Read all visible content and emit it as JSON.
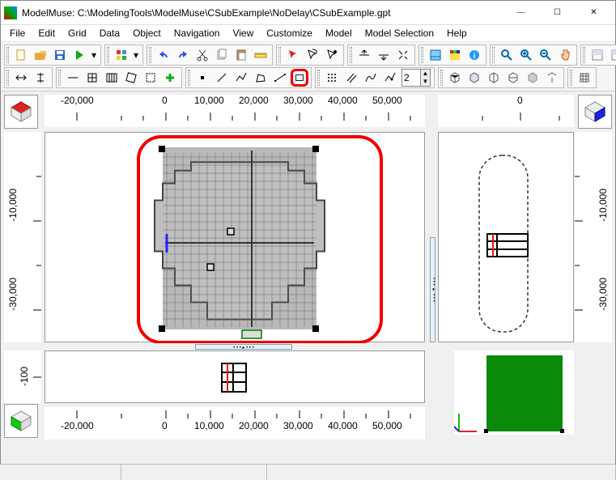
{
  "title": "ModelMuse: C:\\ModelingTools\\ModelMuse\\CSubExample\\NoDelay\\CSubExample.gpt",
  "window_controls": {
    "min": "—",
    "max": "☐",
    "close": "✕"
  },
  "menu": [
    "File",
    "Edit",
    "Grid",
    "Data",
    "Object",
    "Navigation",
    "View",
    "Customize",
    "Model",
    "Model Selection",
    "Help"
  ],
  "spin_value": "2",
  "axes": {
    "top_left": {
      "labels": [
        "-20,000",
        "0",
        "10,000",
        "20,000",
        "30,000",
        "40,000",
        "50,000"
      ],
      "x": [
        84,
        199,
        254,
        309,
        364,
        419,
        474
      ]
    },
    "top_right": {
      "labels": [
        "0"
      ],
      "x": [
        640
      ]
    },
    "left_main": {
      "labels": [
        "-30,000",
        "-10,000"
      ],
      "y": [
        344,
        234
      ]
    },
    "left_bottom": {
      "labels": [
        "-100"
      ],
      "y": [
        466
      ]
    },
    "right_main": {
      "labels": [
        "-30,000",
        "-10,000"
      ],
      "y": [
        344,
        234
      ]
    },
    "bottom": {
      "labels": [
        "-20,000",
        "0",
        "10,000",
        "20,000",
        "30,000",
        "40,000",
        "50,000"
      ],
      "x": [
        84,
        199,
        254,
        309,
        364,
        419,
        474
      ]
    }
  },
  "chart_data": {
    "type": "map-views",
    "description": "ModelMuse grid views (top/plan, front, side, 3D) of a MODFLOW finite-difference grid",
    "plan_view": {
      "x_range": [
        -20000,
        50000
      ],
      "y_range": [
        -30000,
        -10000
      ],
      "grid_active_extent_x": [
        8000,
        32000
      ],
      "grid_active_extent_y": [
        -34000,
        4000
      ],
      "selected_cells": [
        [
          22000,
          -14000
        ],
        [
          22000,
          -22000
        ]
      ],
      "highlighted_object_bbox": true
    },
    "front_view": {
      "x_range": [
        -20000,
        50000
      ],
      "z_range": [
        -200,
        0
      ],
      "layers": 3
    },
    "side_view": {
      "y_range": [
        -30000,
        -10000
      ],
      "z_range": [
        -200,
        0
      ],
      "layers": 3
    },
    "three_d_view": {
      "color": "#0a8a0a"
    }
  }
}
